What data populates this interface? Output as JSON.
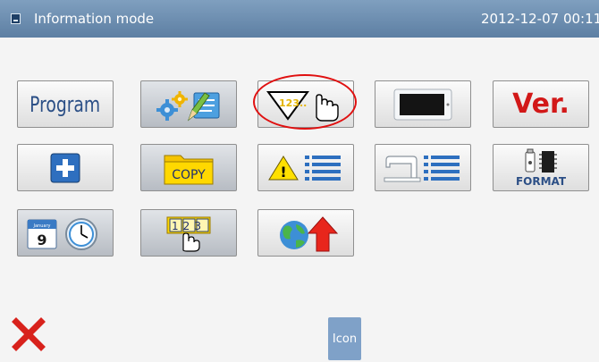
{
  "titlebar": {
    "title": "Information mode",
    "datetime": "2012-12-07  00:11"
  },
  "tiles": {
    "program_label": "Program",
    "ver_label": "Ver.",
    "copy_label": "COPY",
    "format_label": "FORMAT",
    "counter_label": "123..",
    "calendar_month": "January",
    "calendar_day": "9",
    "keypad_label": "123"
  },
  "footer": {
    "icon_button_label": "Icon"
  },
  "icons": [
    "program-text",
    "settings-gears-pencil",
    "counter-hand",
    "monitor-screen",
    "version-text",
    "plus-box",
    "copy-folder",
    "warning-list",
    "sewing-machine-list",
    "usb-format",
    "calendar-clock",
    "keypad-hand",
    "globe-upload"
  ],
  "colors": {
    "titlebar": "#6f90b3",
    "highlight_ellipse": "#e01010",
    "ver_text": "#d21818",
    "program_text": "#2b4f86",
    "icon_button": "#7fa1c8"
  }
}
